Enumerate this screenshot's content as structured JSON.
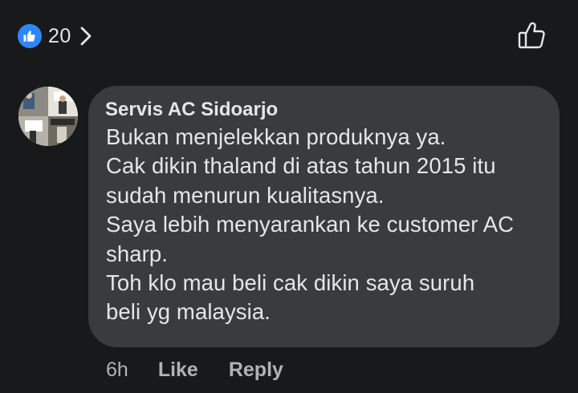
{
  "reactions": {
    "count": "20",
    "reaction_type_icon": "thumbs-up-icon",
    "accent_color": "#2d88ff"
  },
  "top_actions": {
    "like_icon": "thumbs-up-outline-icon"
  },
  "comment": {
    "author": "Servis AC Sidoarjo",
    "text": "Bukan menjelekkan produknya ya.\nCak dikin thaland di atas tahun 2015 itu\nsudah menurun kualitasnya.\nSaya lebih menyarankan ke customer AC\nsharp.\nToh klo mau beli cak dikin saya suruh\nbeli yg malaysia.",
    "timestamp": "6h",
    "like_label": "Like",
    "reply_label": "Reply"
  },
  "colors": {
    "background": "#18191a",
    "bubble": "#3a3b3c",
    "primary_text": "#e4e6eb",
    "secondary_text": "#b0b3b8"
  }
}
